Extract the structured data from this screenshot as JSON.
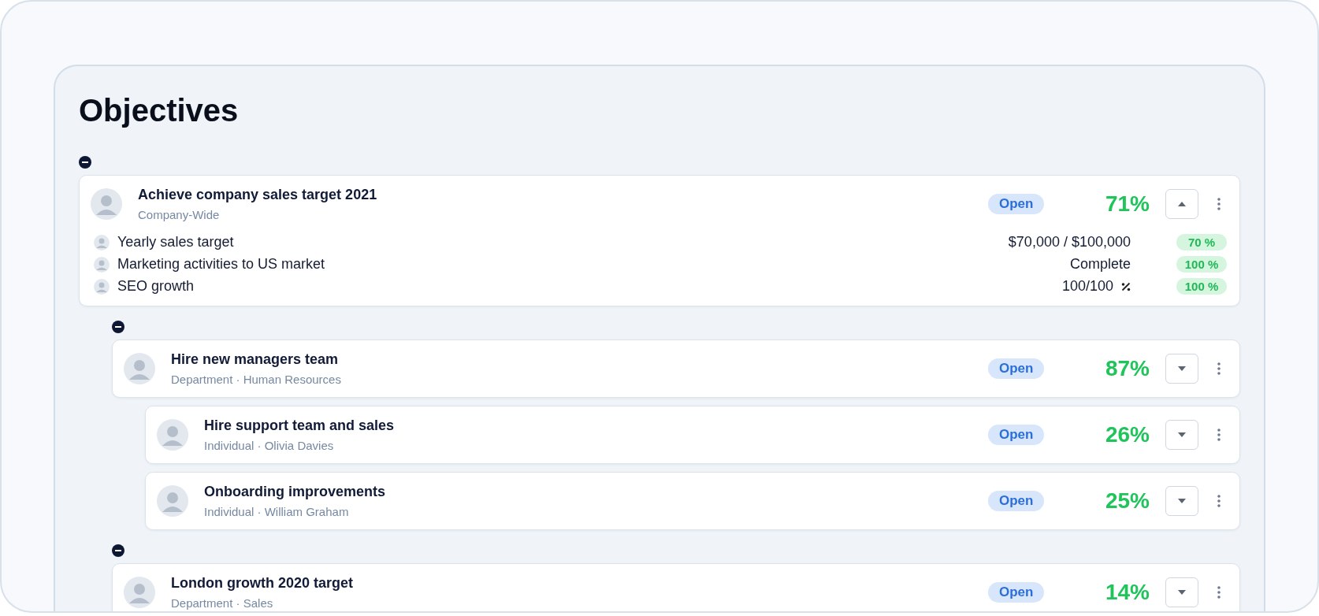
{
  "title": "Objectives",
  "objectives": [
    {
      "title": "Achieve company sales target 2021",
      "subtitle": "Company-Wide",
      "status": "Open",
      "progress": "71%",
      "expanded": true,
      "collapsible": true,
      "key_results": [
        {
          "name": "Yearly sales target",
          "value": "$70,000 / $100,000",
          "percent": "70 %",
          "kind": "currency"
        },
        {
          "name": "Marketing activities to US market",
          "value": "Complete",
          "percent": "100 %",
          "kind": "milestone"
        },
        {
          "name": "SEO growth",
          "value": "100/100",
          "percent": "100 %",
          "kind": "percent"
        }
      ],
      "children": [
        {
          "title": "Hire new managers team",
          "subtitle": "Department · Human Resources",
          "status": "Open",
          "progress": "87%",
          "expanded": false,
          "collapsible": true,
          "children": [
            {
              "title": "Hire support team and sales",
              "subtitle": "Individual · Olivia Davies",
              "status": "Open",
              "progress": "26%",
              "expanded": false,
              "collapsible": false
            },
            {
              "title": "Onboarding improvements",
              "subtitle": "Individual · William Graham",
              "status": "Open",
              "progress": "25%",
              "expanded": false,
              "collapsible": false
            }
          ]
        },
        {
          "title": "London growth 2020 target",
          "subtitle": "Department · Sales",
          "status": "Open",
          "progress": "14%",
          "expanded": false,
          "collapsible": true
        }
      ]
    }
  ]
}
